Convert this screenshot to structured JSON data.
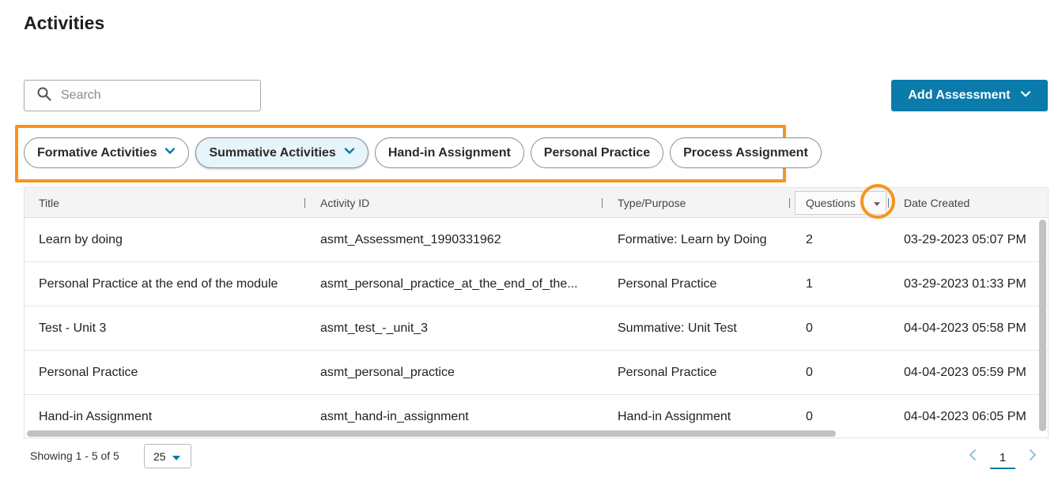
{
  "page": {
    "title": "Activities"
  },
  "search": {
    "placeholder": "Search",
    "value": ""
  },
  "add_assessment": {
    "label": "Add Assessment"
  },
  "filters": [
    {
      "label": "Formative Activities",
      "has_dropdown": true,
      "active": false
    },
    {
      "label": "Summative Activities",
      "has_dropdown": true,
      "active": true
    },
    {
      "label": "Hand-in Assignment",
      "has_dropdown": false,
      "active": false
    },
    {
      "label": "Personal Practice",
      "has_dropdown": false,
      "active": false
    },
    {
      "label": "Process Assignment",
      "has_dropdown": false,
      "active": false
    }
  ],
  "table": {
    "headers": {
      "title": "Title",
      "activity_id": "Activity ID",
      "type": "Type/Purpose",
      "questions": "Questions",
      "date_created": "Date Created"
    },
    "rows": [
      {
        "title": "Learn by doing",
        "activity_id": "asmt_Assessment_1990331962",
        "type": "Formative: Learn by Doing",
        "questions": "2",
        "date_created": "03-29-2023 05:07 PM"
      },
      {
        "title": "Personal Practice at the end of the module",
        "activity_id": "asmt_personal_practice_at_the_end_of_the...",
        "type": "Personal Practice",
        "questions": "1",
        "date_created": "03-29-2023 01:33 PM"
      },
      {
        "title": "Test - Unit 3",
        "activity_id": "asmt_test_-_unit_3",
        "type": "Summative: Unit Test",
        "questions": "0",
        "date_created": "04-04-2023 05:58 PM"
      },
      {
        "title": "Personal Practice",
        "activity_id": "asmt_personal_practice",
        "type": "Personal Practice",
        "questions": "0",
        "date_created": "04-04-2023 05:59 PM"
      },
      {
        "title": "Hand-in Assignment",
        "activity_id": "asmt_hand-in_assignment",
        "type": "Hand-in Assignment",
        "questions": "0",
        "date_created": "04-04-2023 06:05 PM"
      }
    ]
  },
  "footer": {
    "showing": "Showing 1 - 5 of 5",
    "page_size": "25",
    "current_page": "1"
  },
  "colors": {
    "accent": "#0b7bab",
    "highlight": "#f7941d",
    "active_chip_bg": "#e6f4fb"
  },
  "icons": {
    "search": "search-icon",
    "chevron_down": "chevron-down-icon",
    "caret_down": "caret-down-icon",
    "prev": "chevron-left-icon",
    "next": "chevron-right-icon"
  }
}
